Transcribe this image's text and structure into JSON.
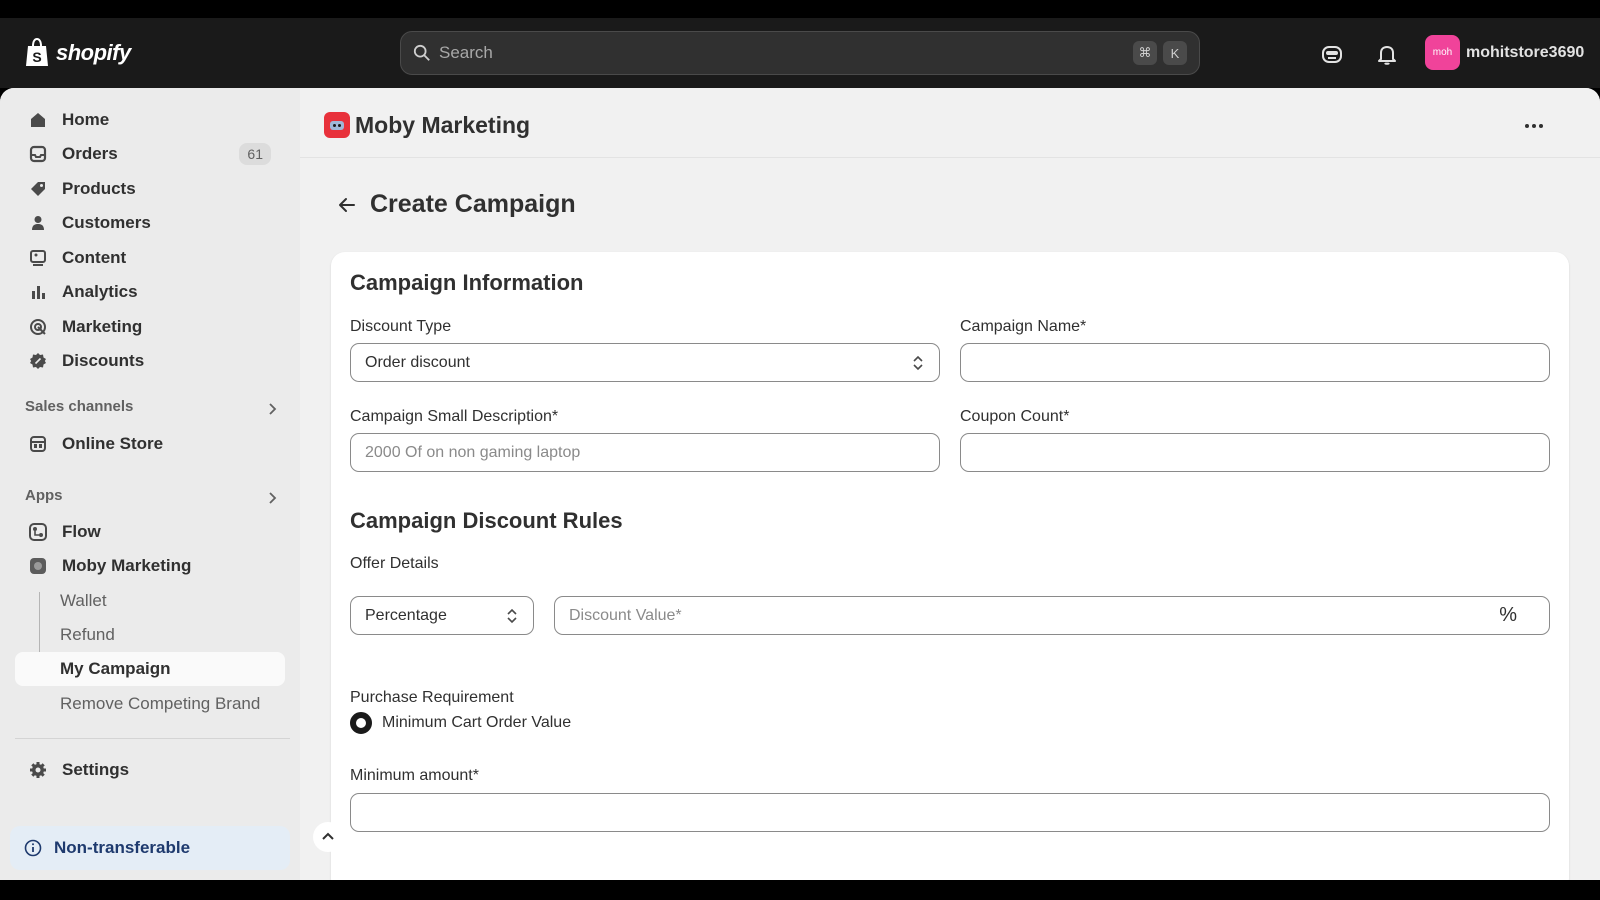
{
  "topbar": {
    "brand": "shopify",
    "search_placeholder": "Search",
    "shortcut_cmd": "⌘",
    "shortcut_key": "K",
    "avatar_initials": "moh",
    "store_name": "mohitstore3690"
  },
  "sidebar": {
    "nav": [
      {
        "label": "Home",
        "icon": "home-icon"
      },
      {
        "label": "Orders",
        "icon": "inbox-icon",
        "badge": "61"
      },
      {
        "label": "Products",
        "icon": "tag-icon"
      },
      {
        "label": "Customers",
        "icon": "person-icon"
      },
      {
        "label": "Content",
        "icon": "content-icon"
      },
      {
        "label": "Analytics",
        "icon": "bar-chart-icon"
      },
      {
        "label": "Marketing",
        "icon": "target-icon"
      },
      {
        "label": "Discounts",
        "icon": "discount-icon"
      }
    ],
    "sales_channels_label": "Sales channels",
    "online_store": "Online Store",
    "apps_label": "Apps",
    "apps": {
      "flow": "Flow",
      "moby": "Moby Marketing",
      "sub": [
        "Wallet",
        "Refund",
        "My Campaign",
        "Remove Competing Brand"
      ]
    },
    "settings": "Settings",
    "non_transferable": "Non-transferable"
  },
  "app": {
    "title": "Moby Marketing",
    "page_title": "Create Campaign"
  },
  "form": {
    "campaign_info_heading": "Campaign Information",
    "discount_type_label": "Discount Type",
    "discount_type_value": "Order discount",
    "campaign_name_label": "Campaign Name*",
    "campaign_name_value": "",
    "small_desc_label": "Campaign Small Description*",
    "small_desc_placeholder": "2000 Of on non gaming laptop",
    "coupon_count_label": "Coupon Count*",
    "coupon_count_value": "",
    "rules_heading": "Campaign Discount Rules",
    "offer_details_label": "Offer Details",
    "offer_type_value": "Percentage",
    "discount_value_placeholder": "Discount Value*",
    "discount_suffix": "%",
    "purchase_req_label": "Purchase Requirement",
    "purchase_req_option": "Minimum Cart Order Value",
    "min_amount_label": "Minimum amount*",
    "min_amount_value": ""
  },
  "colors": {
    "topbar": "#1a1a1a",
    "avatar": "#f0439a",
    "app_icon": "#e8313b",
    "info_banner": "#e4edf6"
  }
}
